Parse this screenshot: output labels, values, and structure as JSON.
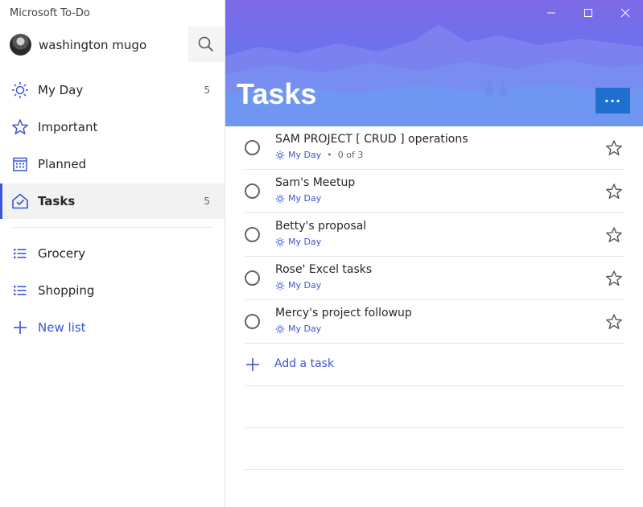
{
  "app": {
    "title": "Microsoft To-Do"
  },
  "profile": {
    "name": "washington mugo",
    "search_icon": "search-icon"
  },
  "sidebar": {
    "items": [
      {
        "label": "My Day",
        "count": "5",
        "icon": "sun-icon"
      },
      {
        "label": "Important",
        "count": "",
        "icon": "star-icon"
      },
      {
        "label": "Planned",
        "count": "",
        "icon": "calendar-icon"
      },
      {
        "label": "Tasks",
        "count": "5",
        "icon": "home-check-icon",
        "active": true
      }
    ],
    "lists": [
      {
        "label": "Grocery",
        "icon": "list-icon"
      },
      {
        "label": "Shopping",
        "icon": "list-icon"
      }
    ],
    "new_list": {
      "label": "New list",
      "icon": "plus-icon"
    }
  },
  "header": {
    "title": "Tasks",
    "more_label": "...",
    "window_controls": [
      "minimize-icon",
      "maximize-icon",
      "close-icon"
    ]
  },
  "tasks": [
    {
      "title": "SAM PROJECT [ CRUD ] operations",
      "tag": "My Day",
      "steps": "0 of 3"
    },
    {
      "title": "Sam's Meetup",
      "tag": "My Day",
      "steps": ""
    },
    {
      "title": "Betty's proposal",
      "tag": "My Day",
      "steps": ""
    },
    {
      "title": "Rose' Excel tasks",
      "tag": "My Day",
      "steps": ""
    },
    {
      "title": "Mercy's project followup",
      "tag": "My Day",
      "steps": ""
    }
  ],
  "add_task": {
    "label": "Add a task"
  },
  "colors": {
    "accent": "#3a55d6",
    "header_top": "#7d6ae6",
    "header_bottom": "#4a86f0",
    "more_button": "#1e6fd0"
  }
}
